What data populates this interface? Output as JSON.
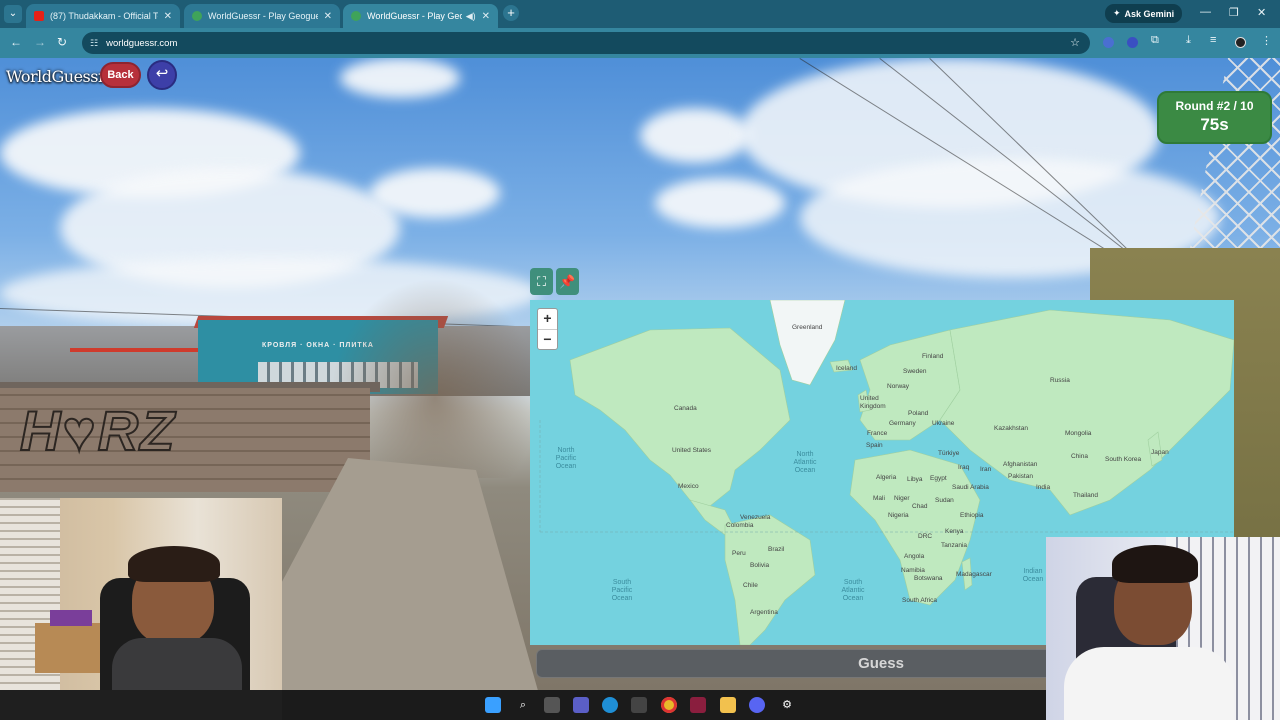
{
  "browser": {
    "tabs": [
      {
        "title": "(87) Thudakkam - Official Teaser",
        "favicon": "youtube-icon",
        "active": false
      },
      {
        "title": "WorldGuessr - Play Geoguessr Free",
        "favicon": "globe-icon",
        "active": false
      },
      {
        "title": "WorldGuessr - Play Geoguessr Free",
        "favicon": "globe-icon",
        "active": true,
        "audio": true
      }
    ],
    "new_tab_label": "+",
    "ask_gemini_label": "Ask Gemini",
    "url": "worldguessr.com"
  },
  "game": {
    "logo": "WorldGuessr",
    "back_label": "Back",
    "undo_icon": "undo-arrow-icon",
    "round_label": "Round #2 / 10",
    "timer": "75s",
    "guess_label": "Guess",
    "map_tools": {
      "fullscreen_icon": "expand-icon",
      "pin_icon": "pin-icon"
    },
    "zoom_in": "+",
    "zoom_out": "−"
  },
  "map_labels": {
    "oceans": [
      "North Pacific Ocean",
      "North Atlantic Ocean",
      "South Pacific Ocean",
      "South Atlantic Ocean",
      "Indian Ocean"
    ],
    "countries": [
      "Greenland",
      "Iceland",
      "Canada",
      "United States",
      "Mexico",
      "Venezuela",
      "Colombia",
      "Peru",
      "Brazil",
      "Bolivia",
      "Chile",
      "Argentina",
      "Finland",
      "Sweden",
      "Norway",
      "United Kingdom",
      "Poland",
      "Germany",
      "France",
      "Spain",
      "Ukraine",
      "Russia",
      "Kazakhstan",
      "Mongolia",
      "China",
      "South Korea",
      "Japan",
      "Türkiye",
      "Iraq",
      "Iran",
      "Afghanistan",
      "Pakistan",
      "India",
      "Thailand",
      "Saudi Arabia",
      "Egypt",
      "Algeria",
      "Libya",
      "Mali",
      "Niger",
      "Chad",
      "Sudan",
      "Ethiopia",
      "Nigeria",
      "Kenya",
      "DRC",
      "Tanzania",
      "Angola",
      "Namibia",
      "Botswana",
      "South Africa",
      "Madagascar"
    ]
  },
  "taskbar": {
    "icons": [
      "windows-start-icon",
      "search-icon",
      "task-view-icon",
      "teams-icon",
      "edge-icon",
      "store-icon",
      "chrome-icon",
      "app-icon",
      "file-explorer-icon",
      "discord-icon",
      "settings-icon"
    ]
  },
  "colors": {
    "back_button": "#b7303b",
    "undo_button": "#3d3fa8",
    "round_box": "#3b8a44",
    "map_ocean": "#74d2df",
    "map_land": "#b9e8b8",
    "browser_frame": "#35869f"
  }
}
